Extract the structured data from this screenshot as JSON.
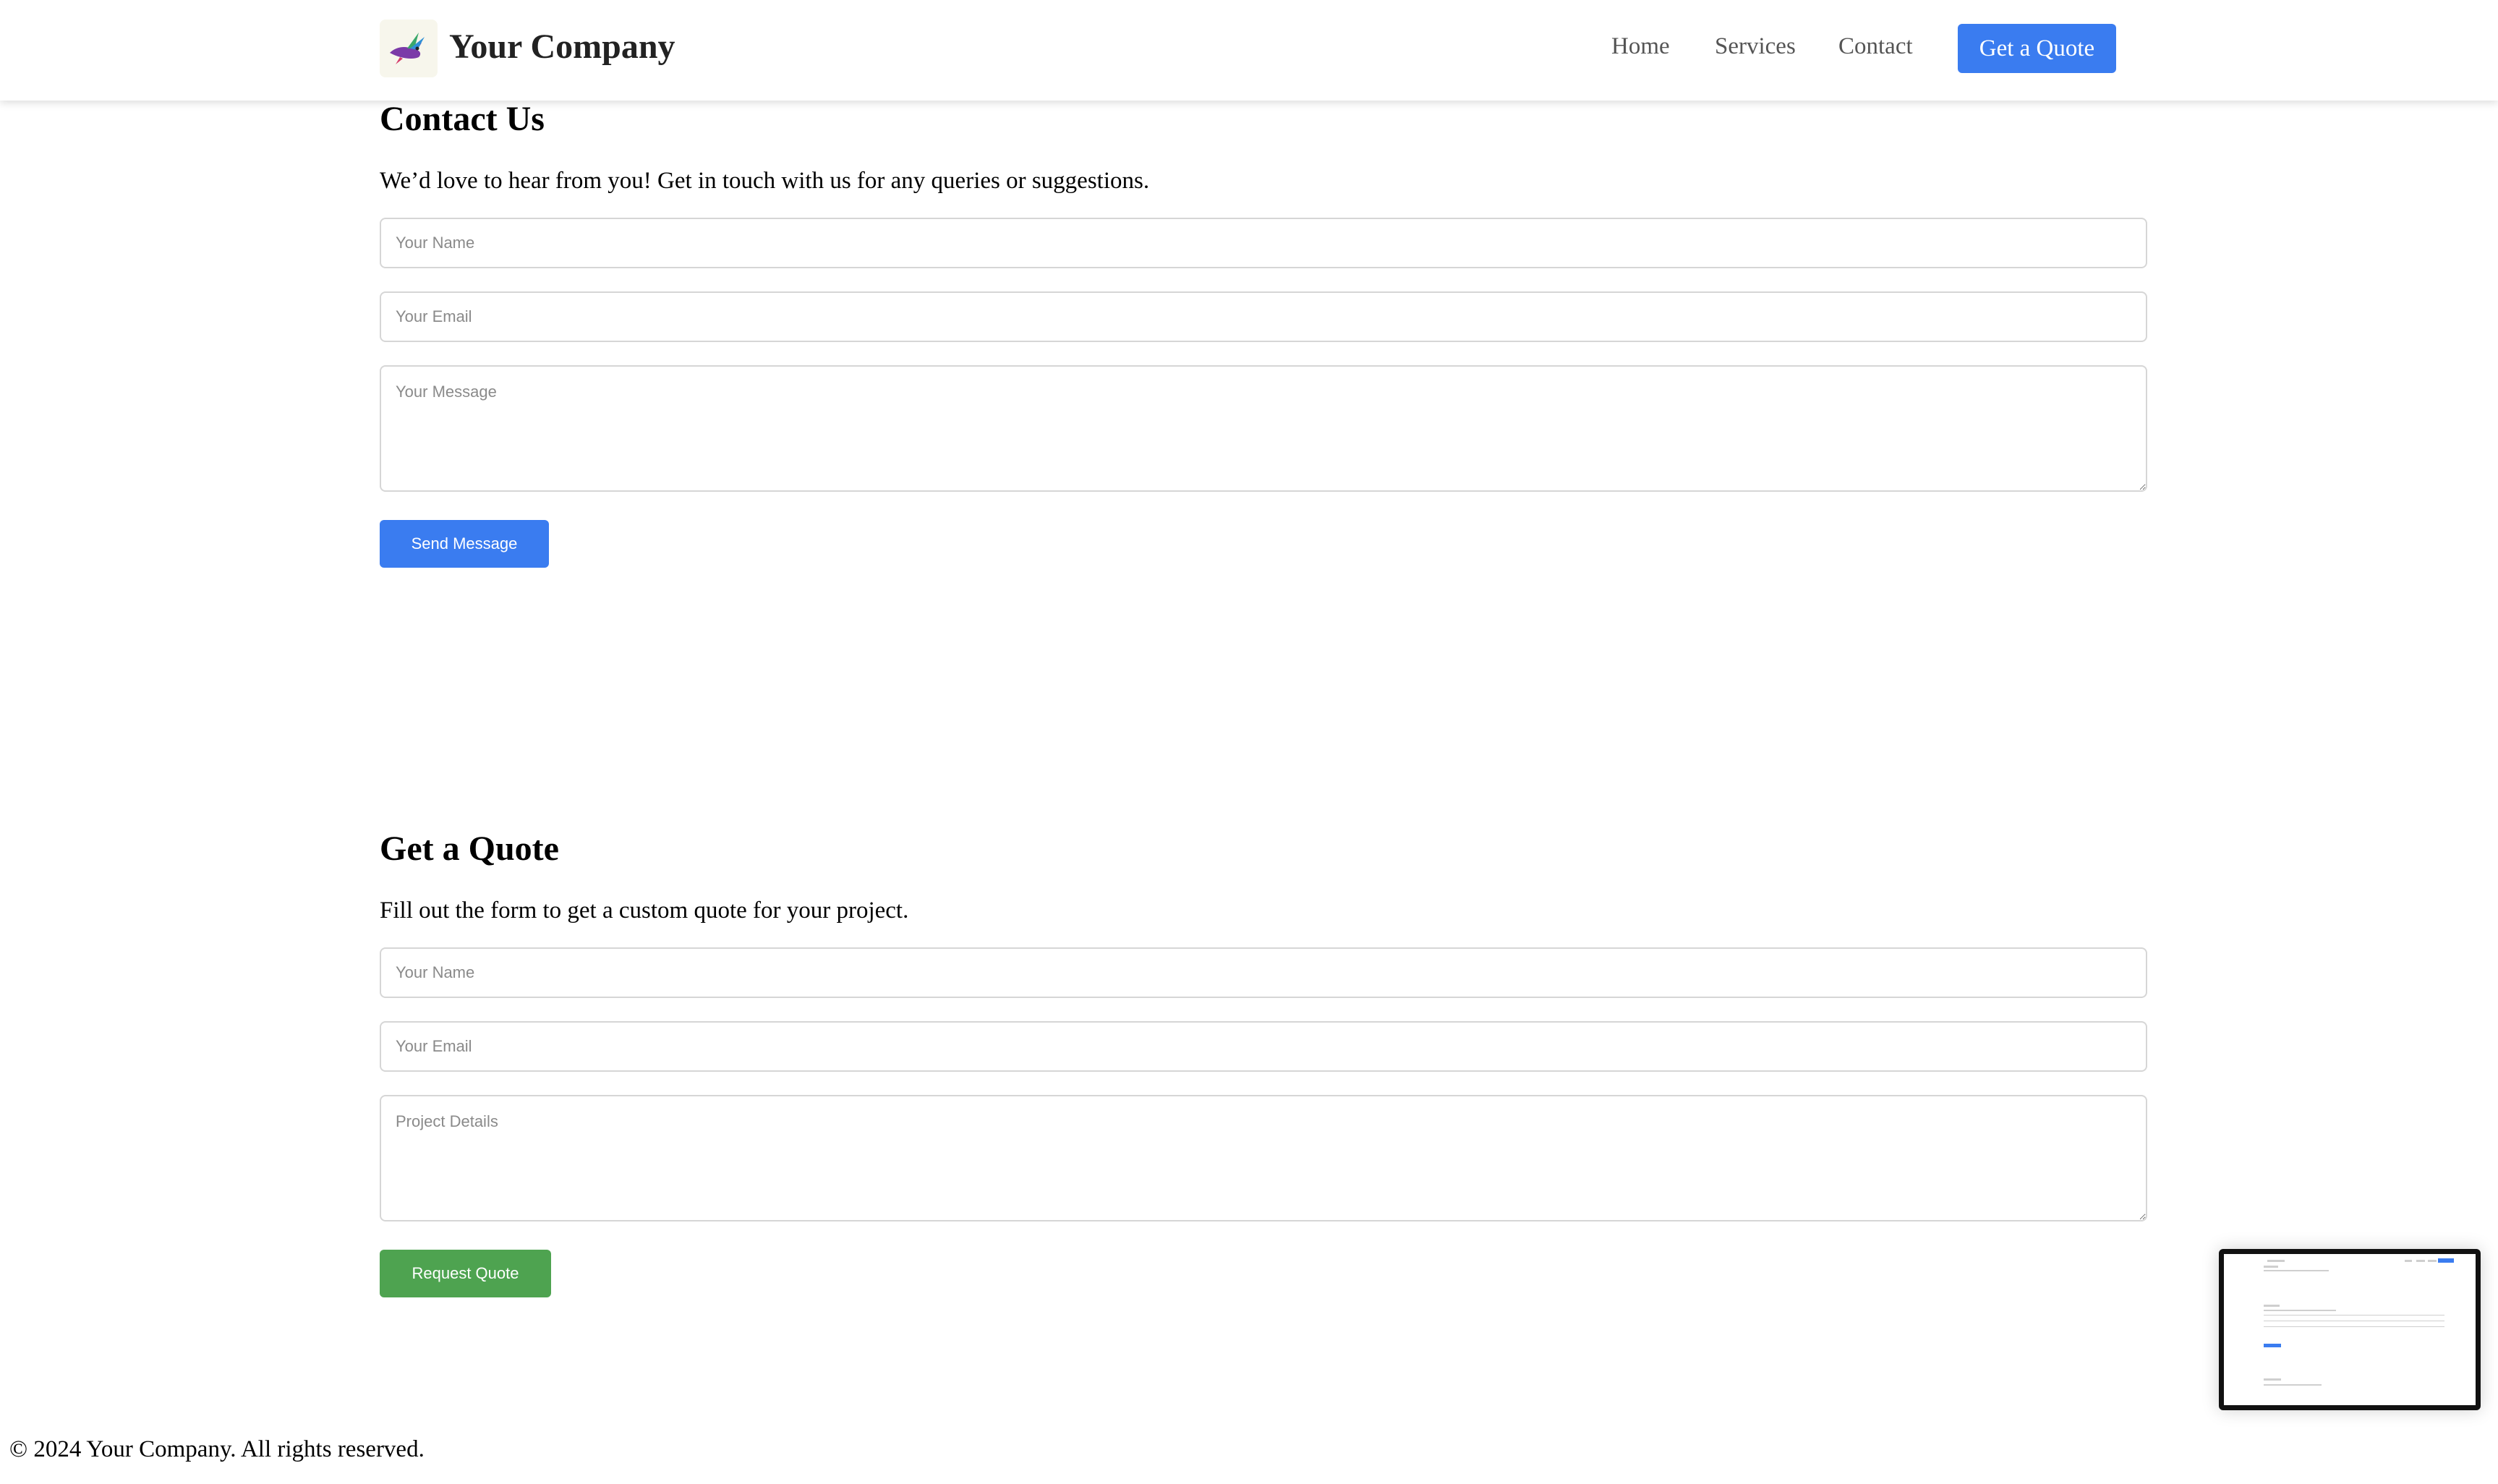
{
  "header": {
    "brand": "Your Company",
    "nav": {
      "home": "Home",
      "services": "Services",
      "contact": "Contact",
      "cta": "Get a Quote"
    }
  },
  "contact": {
    "title": "Contact Us",
    "description": "We’d love to hear from you! Get in touch with us for any queries or suggestions.",
    "name_placeholder": "Your Name",
    "email_placeholder": "Your Email",
    "message_placeholder": "Your Message",
    "submit_label": "Send Message"
  },
  "quote": {
    "title": "Get a Quote",
    "description": "Fill out the form to get a custom quote for your project.",
    "name_placeholder": "Your Name",
    "email_placeholder": "Your Email",
    "details_placeholder": "Project Details",
    "submit_label": "Request Quote"
  },
  "footer": {
    "text": "© 2024 Your Company. All rights reserved."
  },
  "colors": {
    "primary": "#3a7cf0",
    "success": "#4ea350",
    "header_bg": "#ffffff"
  },
  "icons": {
    "logo": "bird-logo-icon"
  }
}
